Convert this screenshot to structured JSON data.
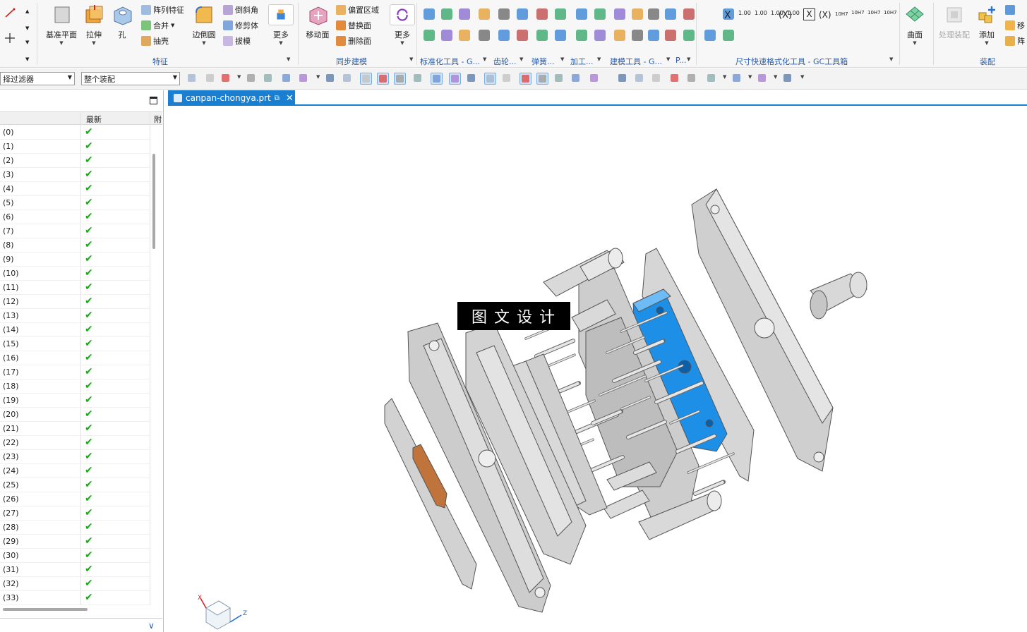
{
  "ribbon": {
    "feature_group": {
      "label": "特征",
      "datum_plane": "基准平面",
      "extrude": "拉伸",
      "hole": "孔",
      "pattern": "阵列特征",
      "unite": "合并",
      "shell": "抽壳",
      "edge_blend": "边倒圆",
      "chamfer": "倒斜角",
      "trim_body": "修剪体",
      "draft": "拔模",
      "more": "更多"
    },
    "sync_group": {
      "label": "同步建模",
      "move_face": "移动面",
      "offset_region": "偏置区域",
      "replace_face": "替换面",
      "delete_face": "删除面",
      "more": "更多"
    },
    "std_tools_label": "标准化工具 - G...",
    "gear_label": "齿轮...",
    "spring_label": "弹簧...",
    "machining_label": "加工...",
    "modeling_tools_label": "建模工具 - G...",
    "p_label": "P...",
    "dim_tools_label": "尺寸快速格式化工具 - GC工具箱",
    "surface_label": "曲面",
    "assembly_group": {
      "label": "装配",
      "process_assembly": "处理装配",
      "add": "添加",
      "move_short": "移",
      "array_short": "阵"
    },
    "dim_text": {
      "x": "X",
      "xp": "(X)",
      "fit1": "10H7",
      "val": "1.00"
    }
  },
  "toolbar2": {
    "filter": "择过滤器",
    "scope": "整个装配"
  },
  "navigator": {
    "col_latest": "最新",
    "col_extra": "附",
    "rows": [
      "(0)",
      "(1)",
      "(2)",
      "(3)",
      "(4)",
      "(5)",
      "(6)",
      "(7)",
      "(8)",
      "(9)",
      "(10)",
      "(11)",
      "(12)",
      "(13)",
      "(14)",
      "(15)",
      "(16)",
      "(17)",
      "(18)",
      "(19)",
      "(20)",
      "(21)",
      "(22)",
      "(23)",
      "(24)",
      "(25)",
      "(26)",
      "(27)",
      "(28)",
      "(29)",
      "(30)",
      "(31)",
      "(32)",
      "(33)"
    ],
    "check_symbol": "✔"
  },
  "document_tab": {
    "filename": "canpan-chongya.prt",
    "close": "✕"
  },
  "viewport": {
    "watermark": "图文设计",
    "axis_x": "X",
    "axis_z": "Z",
    "highlight_color": "#1e8fe6",
    "part_color": "#c9c9c9",
    "insert_color": "#c0733a"
  }
}
